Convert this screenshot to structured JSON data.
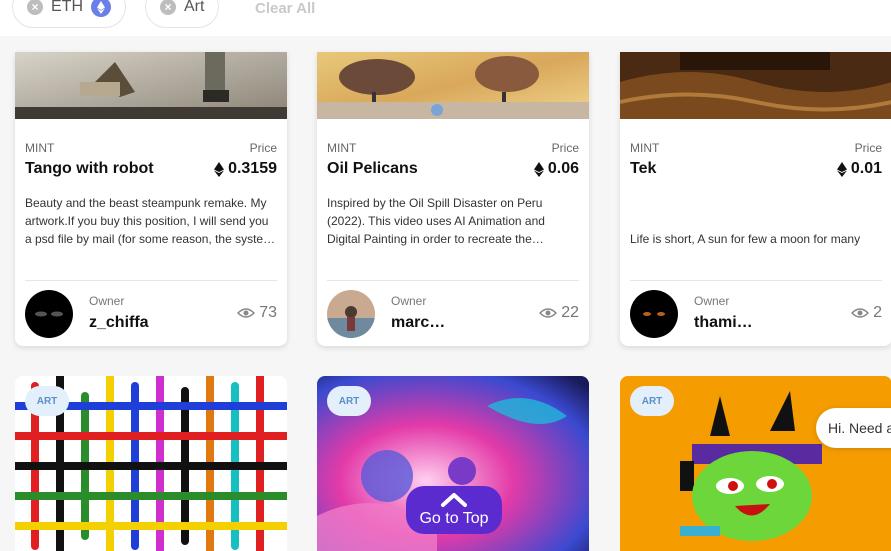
{
  "filters": {
    "chips": [
      {
        "label": "ETH",
        "icon": "ethereum-icon"
      },
      {
        "label": "Art"
      }
    ],
    "clear_all": "Clear All"
  },
  "cards": [
    {
      "type": "MINT",
      "price_label": "Price",
      "title": "Tango with robot",
      "price": "0.3159",
      "description": "Beauty and the beast steampunk remake. My artwork.If you buy this position, I will send you a psd file by mail (for some reason, the syste…",
      "owner_label": "Owner",
      "owner": "z_chiffa",
      "views": "73"
    },
    {
      "type": "MINT",
      "price_label": "Price",
      "title": "Oil Pelicans",
      "price": "0.06",
      "description": "Inspired by the Oil Spill Disaster on Peru (2022). This video uses AI Animation and Digital Painting in order to recreate the…",
      "owner_label": "Owner",
      "owner": "marc…",
      "views": "22"
    },
    {
      "type": "MINT",
      "price_label": "Price",
      "title": "Tek",
      "price": "0.01",
      "description": "Life is short, A sun for few a moon for many",
      "owner_label": "Owner",
      "owner": "thami…",
      "views": "2"
    }
  ],
  "row2_badges": [
    "ART",
    "ART",
    "ART"
  ],
  "chat": {
    "text": "Hi. Need a"
  },
  "go_top": {
    "label": "Go to Top"
  },
  "colors": {
    "accent": "#5b2bd0",
    "badge_bg": "#e3f0fb",
    "badge_text": "#5a8fc8"
  }
}
